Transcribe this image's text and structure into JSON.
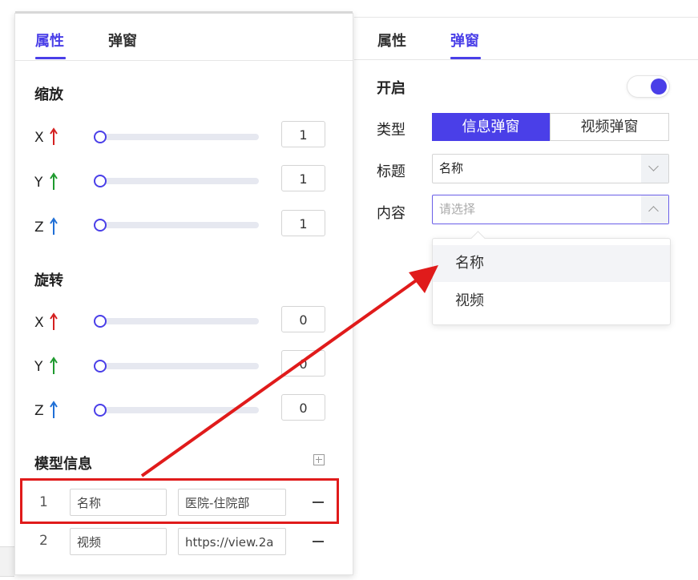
{
  "left_panel": {
    "tabs": [
      {
        "label": "属性",
        "active": true
      },
      {
        "label": "弹窗",
        "active": false
      }
    ],
    "scale": {
      "title": "缩放",
      "rows": [
        {
          "axis": "X",
          "value": "1",
          "slider_fraction": 0.0
        },
        {
          "axis": "Y",
          "value": "1",
          "slider_fraction": 0.0
        },
        {
          "axis": "Z",
          "value": "1",
          "slider_fraction": 0.0
        }
      ]
    },
    "rotation": {
      "title": "旋转",
      "rows": [
        {
          "axis": "X",
          "value": "0",
          "slider_fraction": 0.0
        },
        {
          "axis": "Y",
          "value": "0",
          "slider_fraction": 0.0
        },
        {
          "axis": "Z",
          "value": "0",
          "slider_fraction": 0.0
        }
      ]
    },
    "model_info": {
      "title": "模型信息",
      "add_icon": "plus-square-icon",
      "rows": [
        {
          "index": "1",
          "key": "名称",
          "value": "医院-住院部"
        },
        {
          "index": "2",
          "key": "视频",
          "value": "https://view.2a"
        }
      ]
    },
    "axis_colors": {
      "X": "#d42020",
      "Y": "#1e9a2e",
      "Z": "#1f6fd6"
    }
  },
  "right_panel": {
    "tabs": [
      {
        "label": "属性",
        "active": false
      },
      {
        "label": "弹窗",
        "active": true
      }
    ],
    "enable": {
      "label": "开启",
      "on": true
    },
    "type": {
      "label": "类型",
      "options": [
        "信息弹窗",
        "视频弹窗"
      ],
      "selected": "信息弹窗"
    },
    "title_field": {
      "label": "标题",
      "value": "名称"
    },
    "content_field": {
      "label": "内容",
      "placeholder": "请选择"
    },
    "dropdown_options": [
      "名称",
      "视频"
    ]
  },
  "colors": {
    "accent": "#4a3fe8",
    "highlight": "#e01b1b"
  }
}
